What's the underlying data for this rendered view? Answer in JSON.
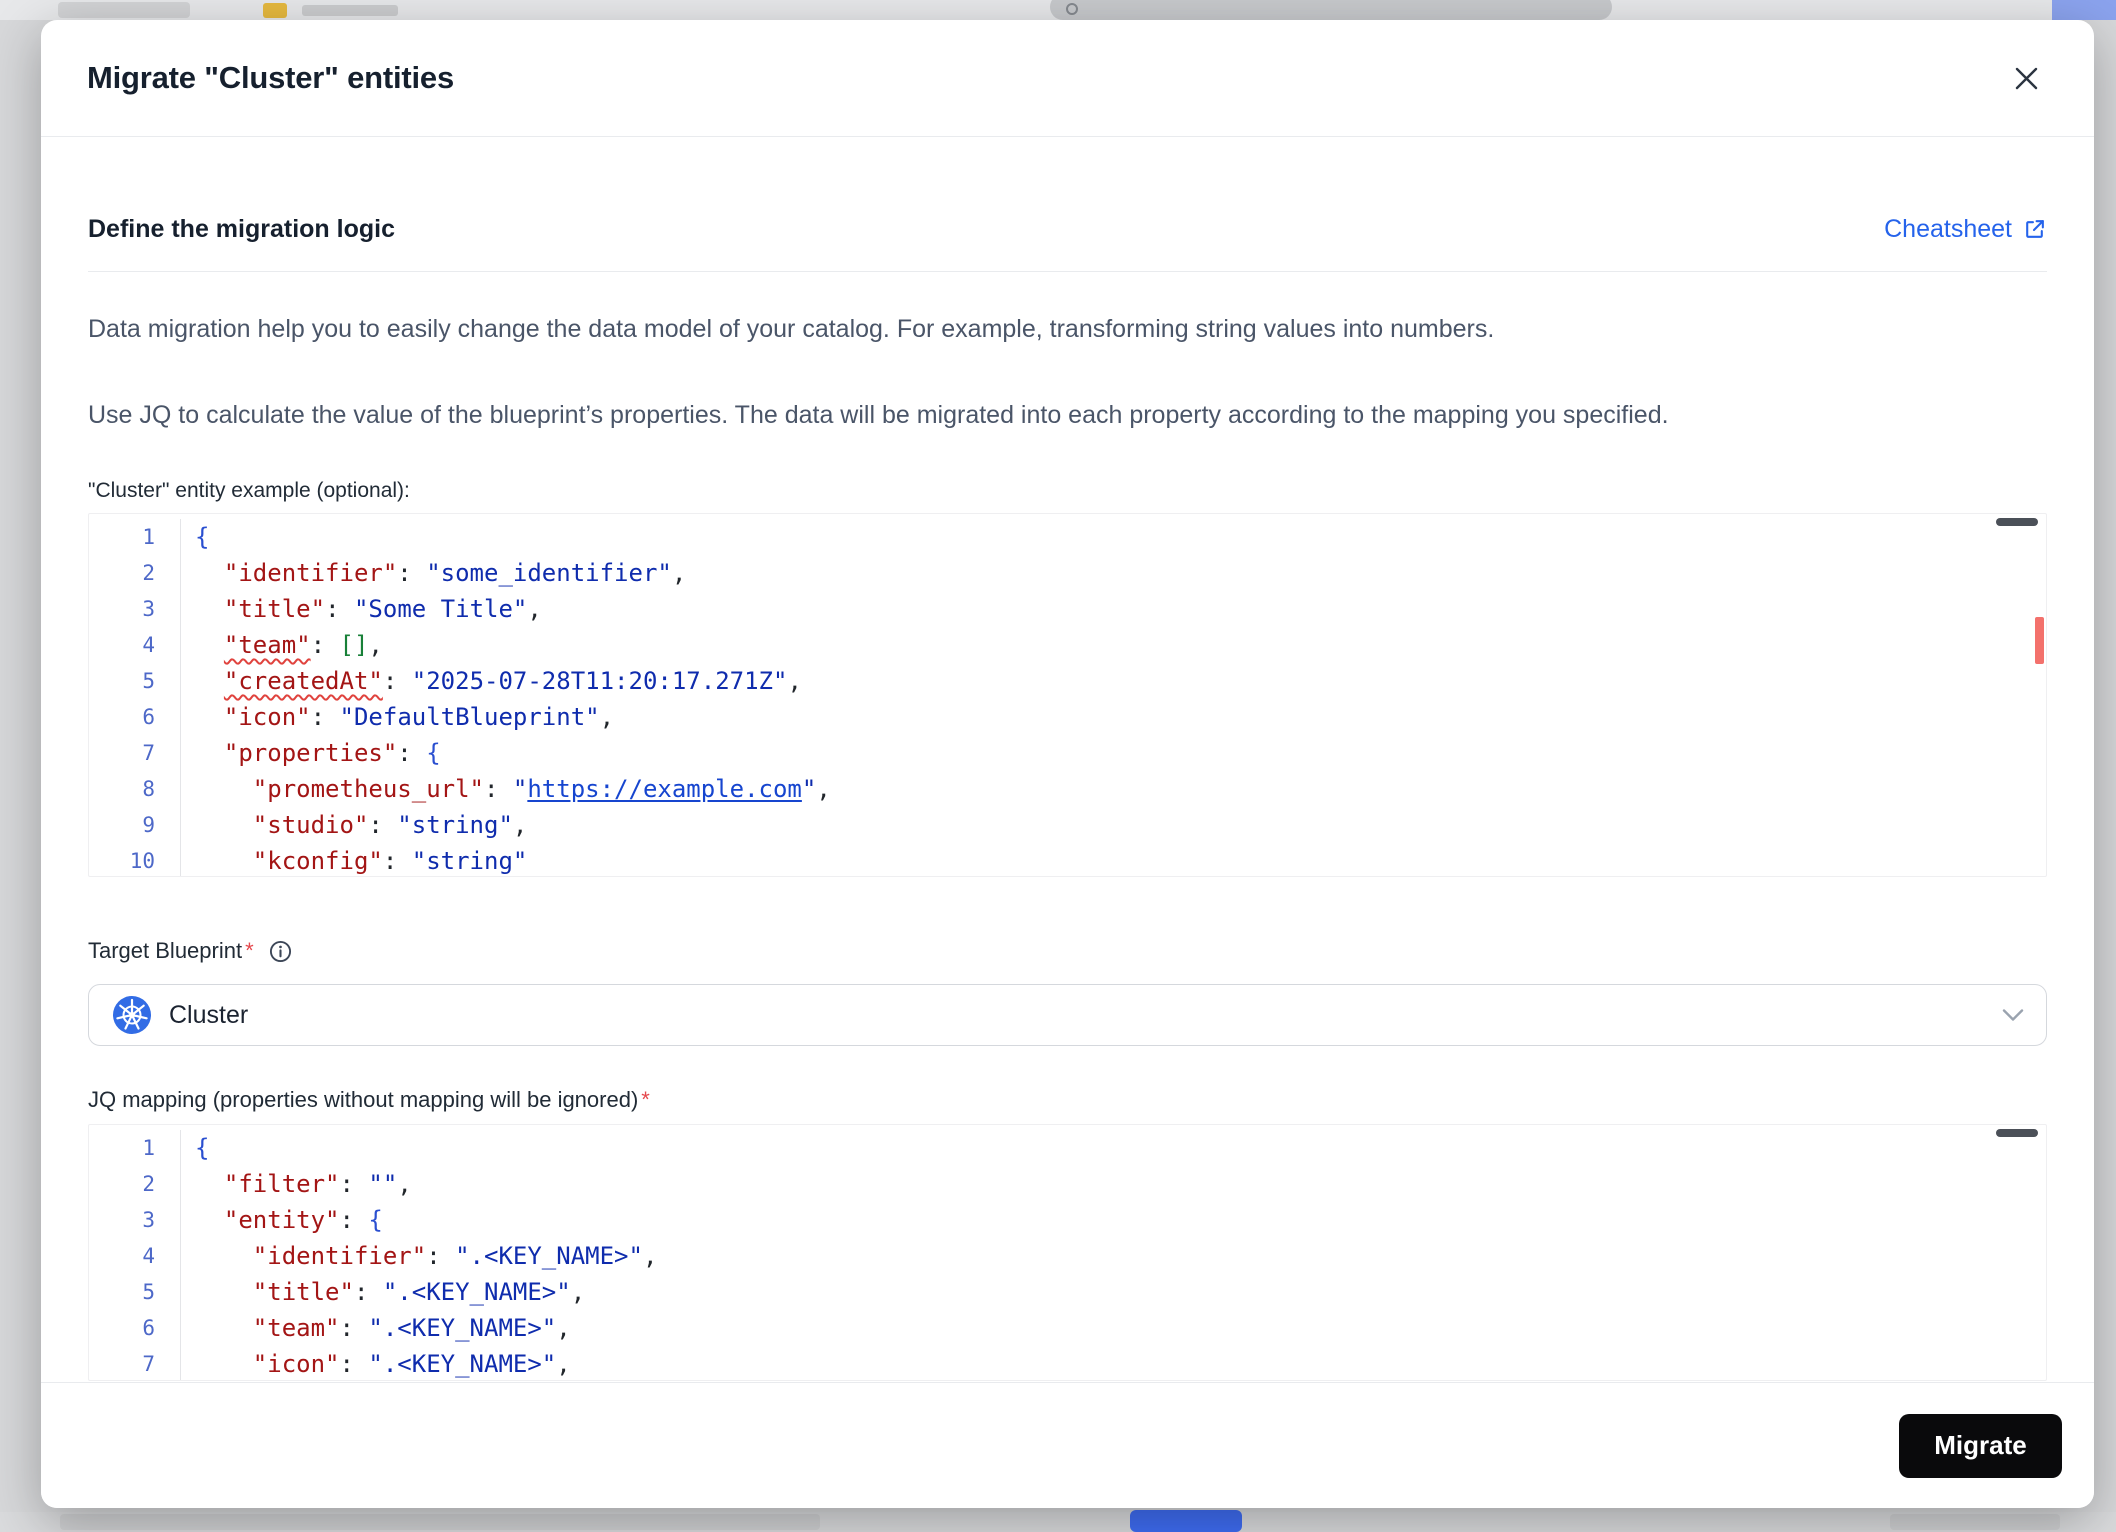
{
  "palette": {
    "accent_blue": "#2563eb",
    "button_black": "#0a0a0c",
    "error_red": "#e0433e",
    "annotation_marker_red": "#f3716c",
    "kubernetes_blue": "#326ce5",
    "code_key": "#a31515",
    "code_string": "#0f2cad",
    "code_link": "#1645cf",
    "code_bracket": "#2a4fd0",
    "code_array_green": "#188038",
    "line_number_blue": "#4d68c8"
  },
  "modal": {
    "title": "Migrate \"Cluster\" entities"
  },
  "migration_section": {
    "heading": "Define the migration logic",
    "cheatsheet_label": "Cheatsheet",
    "description_line_1": "Data migration help you to easily change the data model of your catalog. For example, transforming string values into numbers.",
    "description_line_2": "Use JQ to calculate the value of the blueprint’s properties. The data will be migrated into each property according to the mapping you specified."
  },
  "entity_example": {
    "label": "\"Cluster\" entity example (optional):",
    "lines": [
      [
        {
          "t": "bracket",
          "v": "{"
        }
      ],
      [
        {
          "t": "plain",
          "v": "  "
        },
        {
          "t": "key",
          "v": "\"identifier\""
        },
        {
          "t": "plain",
          "v": ": "
        },
        {
          "t": "string",
          "v": "\"some_identifier\""
        },
        {
          "t": "plain",
          "v": ","
        }
      ],
      [
        {
          "t": "plain",
          "v": "  "
        },
        {
          "t": "key",
          "v": "\"title\""
        },
        {
          "t": "plain",
          "v": ": "
        },
        {
          "t": "string",
          "v": "\"Some Title\""
        },
        {
          "t": "plain",
          "v": ","
        }
      ],
      [
        {
          "t": "plain",
          "v": "  "
        },
        {
          "t": "key-error",
          "v": "\"team\""
        },
        {
          "t": "plain",
          "v": ": "
        },
        {
          "t": "array",
          "v": "[]"
        },
        {
          "t": "plain",
          "v": ","
        }
      ],
      [
        {
          "t": "plain",
          "v": "  "
        },
        {
          "t": "key-error",
          "v": "\"createdAt\""
        },
        {
          "t": "plain",
          "v": ": "
        },
        {
          "t": "string",
          "v": "\"2025-07-28T11:20:17.271Z\""
        },
        {
          "t": "plain",
          "v": ","
        }
      ],
      [
        {
          "t": "plain",
          "v": "  "
        },
        {
          "t": "key",
          "v": "\"icon\""
        },
        {
          "t": "plain",
          "v": ": "
        },
        {
          "t": "string",
          "v": "\"DefaultBlueprint\""
        },
        {
          "t": "plain",
          "v": ","
        }
      ],
      [
        {
          "t": "plain",
          "v": "  "
        },
        {
          "t": "key",
          "v": "\"properties\""
        },
        {
          "t": "plain",
          "v": ": "
        },
        {
          "t": "bracket",
          "v": "{"
        }
      ],
      [
        {
          "t": "plain",
          "v": "    "
        },
        {
          "t": "key",
          "v": "\"prometheus_url\""
        },
        {
          "t": "plain",
          "v": ": "
        },
        {
          "t": "string",
          "v": "\""
        },
        {
          "t": "link",
          "v": "https://example.com"
        },
        {
          "t": "string",
          "v": "\""
        },
        {
          "t": "plain",
          "v": ","
        }
      ],
      [
        {
          "t": "plain",
          "v": "    "
        },
        {
          "t": "key",
          "v": "\"studio\""
        },
        {
          "t": "plain",
          "v": ": "
        },
        {
          "t": "string",
          "v": "\"string\""
        },
        {
          "t": "plain",
          "v": ","
        }
      ],
      [
        {
          "t": "plain",
          "v": "    "
        },
        {
          "t": "key",
          "v": "\"kconfig\""
        },
        {
          "t": "plain",
          "v": ": "
        },
        {
          "t": "string",
          "v": "\"string\""
        }
      ]
    ]
  },
  "target_blueprint": {
    "label": "Target Blueprint",
    "required": "*",
    "selected": "Cluster"
  },
  "jq_mapping": {
    "label": "JQ mapping (properties without mapping will be ignored)",
    "required": "*",
    "lines": [
      [
        {
          "t": "bracket",
          "v": "{"
        }
      ],
      [
        {
          "t": "plain",
          "v": "  "
        },
        {
          "t": "key",
          "v": "\"filter\""
        },
        {
          "t": "plain",
          "v": ": "
        },
        {
          "t": "string",
          "v": "\"\""
        },
        {
          "t": "plain",
          "v": ","
        }
      ],
      [
        {
          "t": "plain",
          "v": "  "
        },
        {
          "t": "key",
          "v": "\"entity\""
        },
        {
          "t": "plain",
          "v": ": "
        },
        {
          "t": "bracket",
          "v": "{"
        }
      ],
      [
        {
          "t": "plain",
          "v": "    "
        },
        {
          "t": "key",
          "v": "\"identifier\""
        },
        {
          "t": "plain",
          "v": ": "
        },
        {
          "t": "string",
          "v": "\".<KEY_NAME>\""
        },
        {
          "t": "plain",
          "v": ","
        }
      ],
      [
        {
          "t": "plain",
          "v": "    "
        },
        {
          "t": "key",
          "v": "\"title\""
        },
        {
          "t": "plain",
          "v": ": "
        },
        {
          "t": "string",
          "v": "\".<KEY_NAME>\""
        },
        {
          "t": "plain",
          "v": ","
        }
      ],
      [
        {
          "t": "plain",
          "v": "    "
        },
        {
          "t": "key",
          "v": "\"team\""
        },
        {
          "t": "plain",
          "v": ": "
        },
        {
          "t": "string",
          "v": "\".<KEY_NAME>\""
        },
        {
          "t": "plain",
          "v": ","
        }
      ],
      [
        {
          "t": "plain",
          "v": "    "
        },
        {
          "t": "key",
          "v": "\"icon\""
        },
        {
          "t": "plain",
          "v": ": "
        },
        {
          "t": "string",
          "v": "\".<KEY_NAME>\""
        },
        {
          "t": "plain",
          "v": ","
        }
      ]
    ]
  },
  "footer": {
    "migrate_label": "Migrate"
  }
}
